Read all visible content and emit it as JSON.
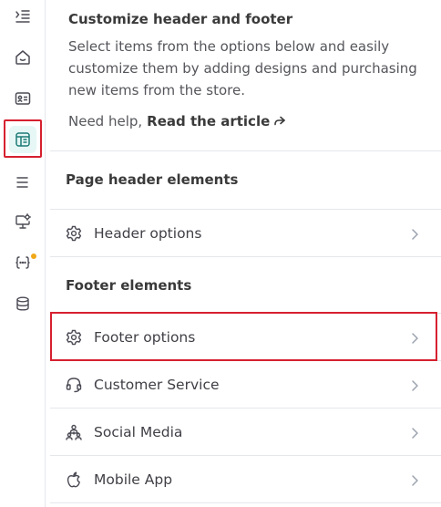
{
  "rail": {
    "items": [
      {
        "name": "collapse-menu-icon"
      },
      {
        "name": "home-icon"
      },
      {
        "name": "profile-card-icon"
      },
      {
        "name": "layout-icon",
        "active": true
      },
      {
        "name": "menu-lines-icon"
      },
      {
        "name": "monitor-settings-icon"
      },
      {
        "name": "code-braces-icon",
        "badge": true
      },
      {
        "name": "database-icon"
      }
    ],
    "accent_color": "#d6202f",
    "badge_color": "#f0a818"
  },
  "intro": {
    "title": "Customize header and footer",
    "description": "Select items from the options below and easily customize them by adding designs and purchasing new items from the store.",
    "help_prefix": "Need help,",
    "help_link": "Read the article"
  },
  "header_section": {
    "title": "Page header elements",
    "rows": [
      {
        "label": "Header options",
        "icon": "gear-icon"
      }
    ]
  },
  "footer_section": {
    "title": "Footer elements",
    "rows": [
      {
        "label": "Footer options",
        "icon": "gear-icon",
        "highlighted": true
      },
      {
        "label": "Customer Service",
        "icon": "headset-icon"
      },
      {
        "label": "Social Media",
        "icon": "social-network-icon"
      },
      {
        "label": "Mobile App",
        "icon": "apple-icon"
      }
    ]
  }
}
